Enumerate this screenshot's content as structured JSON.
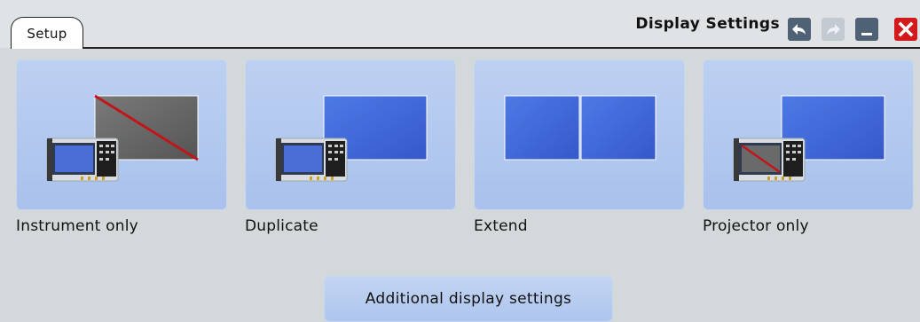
{
  "header": {
    "tab_label": "Setup",
    "title": "Display Settings",
    "buttons": [
      "undo-icon",
      "redo-icon",
      "minimize-icon",
      "close-icon"
    ]
  },
  "options": [
    {
      "label": "Instrument only",
      "icon": "instrument-only-icon"
    },
    {
      "label": "Duplicate",
      "icon": "duplicate-display-icon"
    },
    {
      "label": "Extend",
      "icon": "extend-display-icon"
    },
    {
      "label": "Projector only",
      "icon": "projector-only-icon"
    }
  ],
  "additional_button_label": "Additional display settings",
  "colors": {
    "background": "#d3d8db",
    "card": "#b4c9ef",
    "screen_blue": "#3b63d8",
    "close_red": "#d2191b",
    "header_button": "#4f6275"
  }
}
